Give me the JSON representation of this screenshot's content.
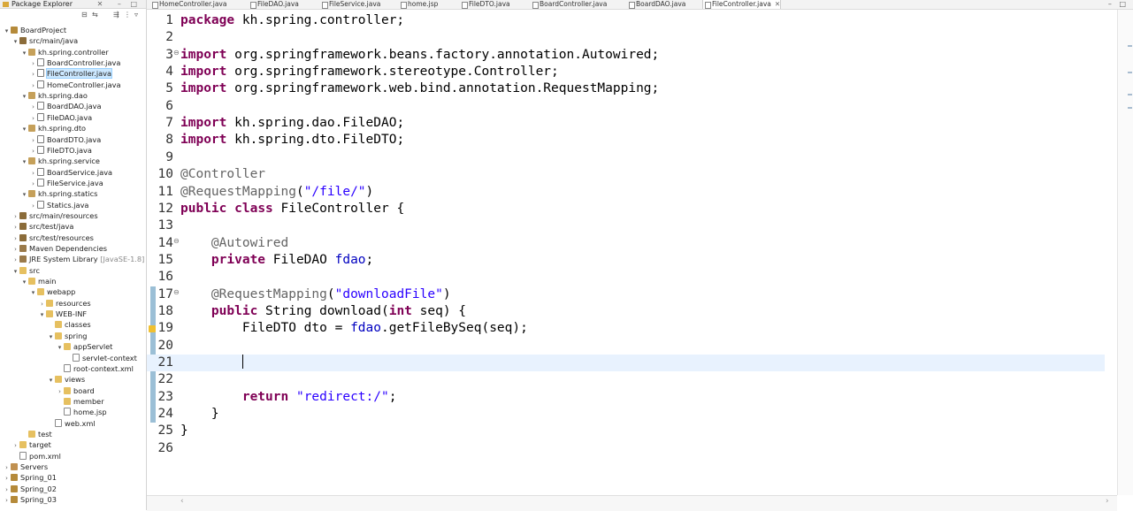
{
  "package_explorer": {
    "title": "Package Explorer",
    "tree": [
      {
        "label": "BoardProject",
        "icon": "project-icon",
        "twisty": "▾",
        "indent": 0
      },
      {
        "label": "src/main/java",
        "icon": "source-folder-icon",
        "twisty": "▾",
        "indent": 1
      },
      {
        "label": "kh.spring.controller",
        "icon": "package-icon",
        "twisty": "▾",
        "indent": 2
      },
      {
        "label": "BoardController.java",
        "icon": "java-file-icon",
        "twisty": "›",
        "indent": 3
      },
      {
        "label": "FileController.java",
        "icon": "java-file-icon",
        "twisty": "›",
        "indent": 3,
        "selected": true
      },
      {
        "label": "HomeController.java",
        "icon": "java-file-icon",
        "twisty": "›",
        "indent": 3
      },
      {
        "label": "kh.spring.dao",
        "icon": "package-icon",
        "twisty": "▾",
        "indent": 2
      },
      {
        "label": "BoardDAO.java",
        "icon": "java-file-icon",
        "twisty": "›",
        "indent": 3
      },
      {
        "label": "FileDAO.java",
        "icon": "java-file-icon",
        "twisty": "›",
        "indent": 3
      },
      {
        "label": "kh.spring.dto",
        "icon": "package-icon",
        "twisty": "▾",
        "indent": 2
      },
      {
        "label": "BoardDTO.java",
        "icon": "java-file-icon",
        "twisty": "›",
        "indent": 3
      },
      {
        "label": "FileDTO.java",
        "icon": "java-file-icon",
        "twisty": "›",
        "indent": 3
      },
      {
        "label": "kh.spring.service",
        "icon": "package-icon",
        "twisty": "▾",
        "indent": 2
      },
      {
        "label": "BoardService.java",
        "icon": "java-file-icon",
        "twisty": "›",
        "indent": 3
      },
      {
        "label": "FileService.java",
        "icon": "java-file-icon",
        "twisty": "›",
        "indent": 3
      },
      {
        "label": "kh.spring.statics",
        "icon": "package-icon",
        "twisty": "▾",
        "indent": 2
      },
      {
        "label": "Statics.java",
        "icon": "java-file-icon",
        "twisty": "›",
        "indent": 3
      },
      {
        "label": "src/main/resources",
        "icon": "source-folder-icon",
        "twisty": "›",
        "indent": 1
      },
      {
        "label": "src/test/java",
        "icon": "source-folder-icon",
        "twisty": "›",
        "indent": 1
      },
      {
        "label": "src/test/resources",
        "icon": "source-folder-icon",
        "twisty": "›",
        "indent": 1
      },
      {
        "label": "Maven Dependencies",
        "icon": "library-icon",
        "twisty": "›",
        "indent": 1
      },
      {
        "label": "JRE System Library",
        "suffix": "[JavaSE-1.8]",
        "icon": "library-icon",
        "twisty": "›",
        "indent": 1
      },
      {
        "label": "src",
        "icon": "folder-icon",
        "twisty": "▾",
        "indent": 1
      },
      {
        "label": "main",
        "icon": "folder-icon",
        "twisty": "▾",
        "indent": 2
      },
      {
        "label": "webapp",
        "icon": "folder-icon",
        "twisty": "▾",
        "indent": 3
      },
      {
        "label": "resources",
        "icon": "folder-icon",
        "twisty": "›",
        "indent": 4
      },
      {
        "label": "WEB-INF",
        "icon": "folder-icon",
        "twisty": "▾",
        "indent": 4
      },
      {
        "label": "classes",
        "icon": "folder-icon",
        "twisty": "",
        "indent": 5
      },
      {
        "label": "spring",
        "icon": "folder-icon",
        "twisty": "▾",
        "indent": 5
      },
      {
        "label": "appServlet",
        "icon": "folder-icon",
        "twisty": "▾",
        "indent": 6
      },
      {
        "label": "servlet-context",
        "icon": "xml-file-icon",
        "twisty": "",
        "indent": 7
      },
      {
        "label": "root-context.xml",
        "icon": "xml-file-icon",
        "twisty": "",
        "indent": 6
      },
      {
        "label": "views",
        "icon": "folder-icon",
        "twisty": "▾",
        "indent": 5
      },
      {
        "label": "board",
        "icon": "folder-icon",
        "twisty": "›",
        "indent": 6
      },
      {
        "label": "member",
        "icon": "folder-icon",
        "twisty": "",
        "indent": 6
      },
      {
        "label": "home.jsp",
        "icon": "jsp-file-icon",
        "twisty": "",
        "indent": 6
      },
      {
        "label": "web.xml",
        "icon": "xml-file-icon",
        "twisty": "",
        "indent": 5
      },
      {
        "label": "test",
        "icon": "folder-icon",
        "twisty": "",
        "indent": 2
      },
      {
        "label": "target",
        "icon": "folder-icon",
        "twisty": "›",
        "indent": 1
      },
      {
        "label": "pom.xml",
        "icon": "xml-file-icon",
        "twisty": "",
        "indent": 1
      },
      {
        "label": "Servers",
        "icon": "server-folder-icon",
        "twisty": "›",
        "indent": 0
      },
      {
        "label": "Spring_01",
        "icon": "project-icon",
        "twisty": "›",
        "indent": 0
      },
      {
        "label": "Spring_02",
        "icon": "project-icon",
        "twisty": "›",
        "indent": 0
      },
      {
        "label": "Spring_03",
        "icon": "project-icon",
        "twisty": "›",
        "indent": 0
      }
    ]
  },
  "editor_tabs": [
    {
      "label": "HomeController.java",
      "active": false
    },
    {
      "label": "FileDAO.java",
      "active": false
    },
    {
      "label": "FileService.java",
      "active": false
    },
    {
      "label": "home.jsp",
      "active": false
    },
    {
      "label": "FileDTO.java",
      "active": false
    },
    {
      "label": "BoardController.java",
      "active": false
    },
    {
      "label": "BoardDAO.java",
      "active": false
    },
    {
      "label": "FileController.java",
      "active": true,
      "close": "✕"
    }
  ],
  "editor": {
    "current_line": 21,
    "lines": [
      {
        "n": "1",
        "tokens": [
          {
            "t": "package",
            "c": "kw"
          },
          {
            "t": " kh.spring.controller;"
          }
        ]
      },
      {
        "n": "2",
        "tokens": []
      },
      {
        "n": "3",
        "fold": "⊖",
        "tokens": [
          {
            "t": "import",
            "c": "kw"
          },
          {
            "t": " org.springframework.beans.factory.annotation.Autowired;"
          }
        ]
      },
      {
        "n": "4",
        "tokens": [
          {
            "t": "import",
            "c": "kw"
          },
          {
            "t": " org.springframework.stereotype.Controller;"
          }
        ]
      },
      {
        "n": "5",
        "tokens": [
          {
            "t": "import",
            "c": "kw"
          },
          {
            "t": " org.springframework.web.bind.annotation.RequestMapping;"
          }
        ]
      },
      {
        "n": "6",
        "tokens": []
      },
      {
        "n": "7",
        "tokens": [
          {
            "t": "import",
            "c": "kw"
          },
          {
            "t": " kh.spring.dao.FileDAO;"
          }
        ]
      },
      {
        "n": "8",
        "tokens": [
          {
            "t": "import",
            "c": "kw"
          },
          {
            "t": " kh.spring.dto.FileDTO;"
          }
        ]
      },
      {
        "n": "9",
        "tokens": []
      },
      {
        "n": "10",
        "tokens": [
          {
            "t": "@Controller",
            "c": "ann"
          }
        ]
      },
      {
        "n": "11",
        "tokens": [
          {
            "t": "@RequestMapping",
            "c": "ann"
          },
          {
            "t": "("
          },
          {
            "t": "\"/file/\"",
            "c": "str"
          },
          {
            "t": ")"
          }
        ]
      },
      {
        "n": "12",
        "tokens": [
          {
            "t": "public",
            "c": "kw"
          },
          {
            "t": " "
          },
          {
            "t": "class",
            "c": "kw"
          },
          {
            "t": " FileController {"
          }
        ]
      },
      {
        "n": "13",
        "tokens": []
      },
      {
        "n": "14",
        "fold": "⊖",
        "tokens": [
          {
            "t": "    "
          },
          {
            "t": "@Autowired",
            "c": "ann"
          }
        ]
      },
      {
        "n": "15",
        "tokens": [
          {
            "t": "    "
          },
          {
            "t": "private",
            "c": "kw"
          },
          {
            "t": " FileDAO "
          },
          {
            "t": "fdao",
            "c": "fld"
          },
          {
            "t": ";"
          }
        ]
      },
      {
        "n": "16",
        "tokens": []
      },
      {
        "n": "17",
        "fold": "⊖",
        "tokens": [
          {
            "t": "    "
          },
          {
            "t": "@RequestMapping",
            "c": "ann"
          },
          {
            "t": "("
          },
          {
            "t": "\"downloadFile\"",
            "c": "str"
          },
          {
            "t": ")"
          }
        ]
      },
      {
        "n": "18",
        "tokens": [
          {
            "t": "    "
          },
          {
            "t": "public",
            "c": "kw"
          },
          {
            "t": " String download("
          },
          {
            "t": "int",
            "c": "kw"
          },
          {
            "t": " seq) {"
          }
        ]
      },
      {
        "n": "19",
        "warn": true,
        "tokens": [
          {
            "t": "        FileDTO dto = "
          },
          {
            "t": "fdao",
            "c": "fld"
          },
          {
            "t": ".getFileBySeq(seq);"
          }
        ]
      },
      {
        "n": "20",
        "tokens": []
      },
      {
        "n": "21",
        "caret": true,
        "tokens": [
          {
            "t": "        "
          }
        ]
      },
      {
        "n": "22",
        "tokens": []
      },
      {
        "n": "23",
        "tokens": [
          {
            "t": "        "
          },
          {
            "t": "return",
            "c": "kw"
          },
          {
            "t": " "
          },
          {
            "t": "\"redirect:/\"",
            "c": "str"
          },
          {
            "t": ";"
          }
        ]
      },
      {
        "n": "24",
        "tokens": [
          {
            "t": "    }"
          }
        ]
      },
      {
        "n": "25",
        "tokens": [
          {
            "t": "}"
          }
        ]
      },
      {
        "n": "26",
        "tokens": []
      }
    ]
  },
  "colors": {
    "keyword": "#7f0055",
    "annotation": "#646464",
    "string": "#2a00ff",
    "field": "#0000c0",
    "current_line": "#e8f2fe",
    "change_bar": "#9bbfd6"
  }
}
